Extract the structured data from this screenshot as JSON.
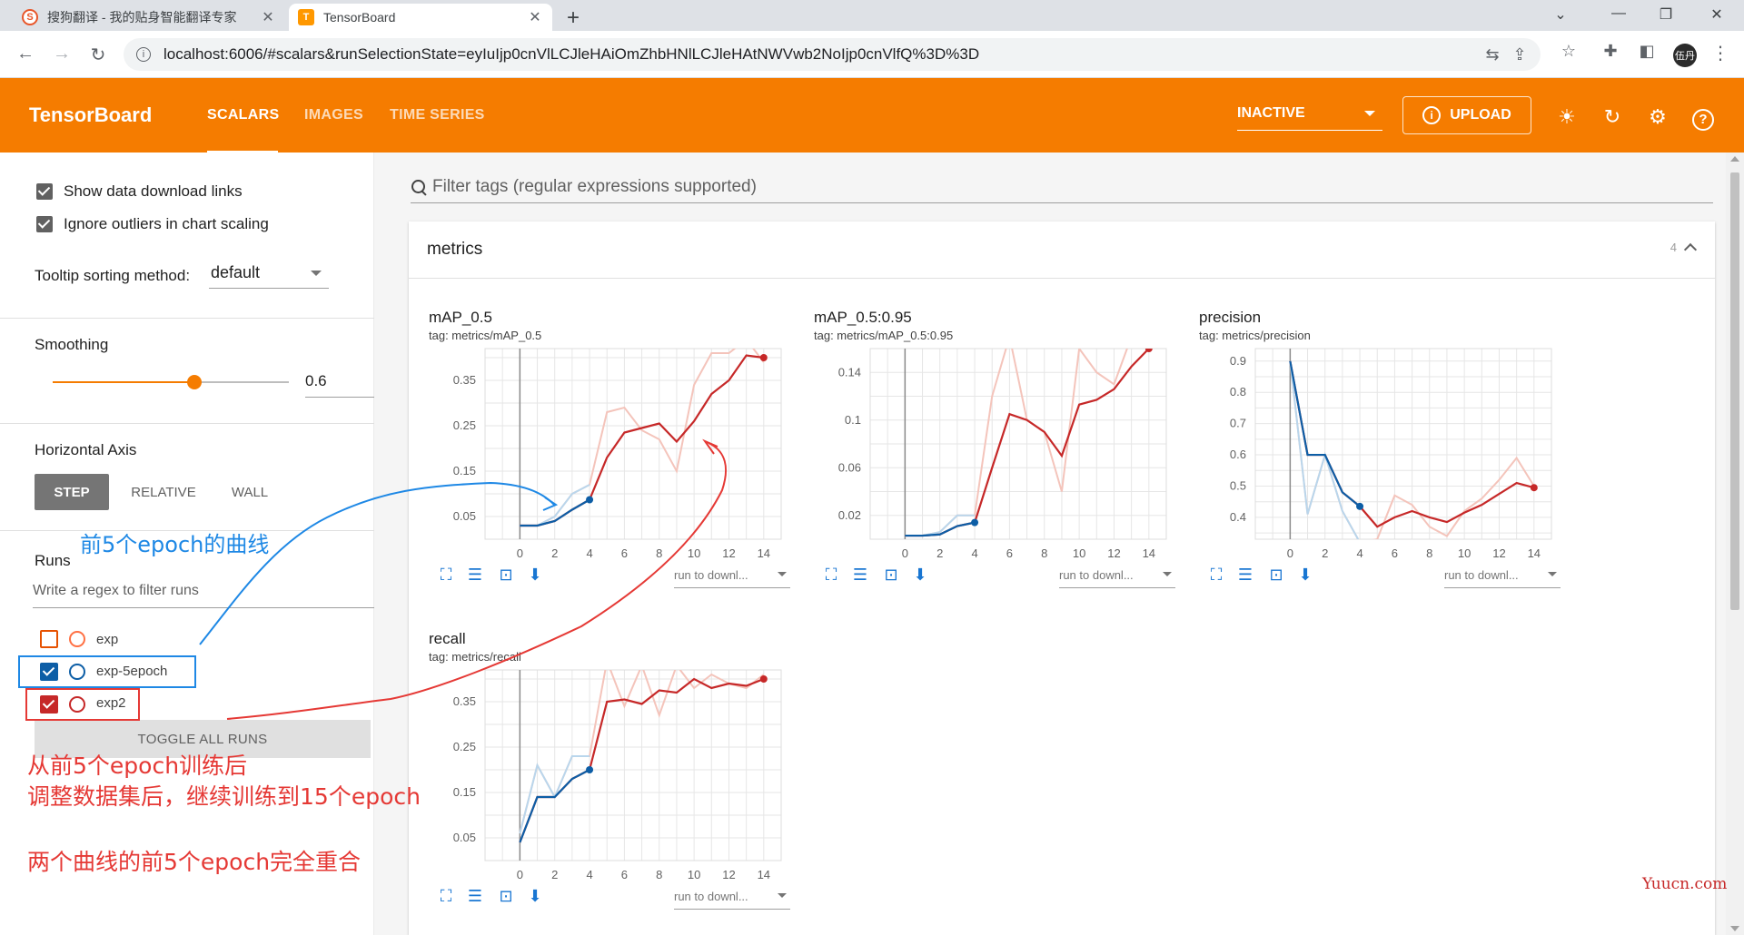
{
  "browser": {
    "tabs": [
      {
        "title": "搜狗翻译 - 我的贴身智能翻译专家",
        "active": false,
        "icon": "sogou-icon"
      },
      {
        "title": "TensorBoard",
        "active": true,
        "icon": "tensorboard-icon"
      }
    ],
    "url": "localhost:6006/#scalars&runSelectionState=eyIuIjp0cnVlLCJleHAiOmZhbHNlLCJleHAtNWVwb2NoIjp0cnVlfQ%3D%3D",
    "avatar_text": "伍丹"
  },
  "header": {
    "title": "TensorBoard",
    "tabs": [
      {
        "label": "SCALARS",
        "active": true
      },
      {
        "label": "IMAGES",
        "active": false
      },
      {
        "label": "TIME SERIES",
        "active": false
      }
    ],
    "reload_status": "INACTIVE",
    "upload_label": "UPLOAD",
    "accent": "#f57c00"
  },
  "sidebar": {
    "show_download_links": {
      "label": "Show data download links",
      "checked": true
    },
    "ignore_outliers": {
      "label": "Ignore outliers in chart scaling",
      "checked": true
    },
    "tooltip_sorting": {
      "label": "Tooltip sorting method:",
      "value": "default"
    },
    "smoothing": {
      "label": "Smoothing",
      "value": "0.6",
      "fraction": 0.6
    },
    "horizontal_axis": {
      "label": "Horizontal Axis",
      "options": [
        "STEP",
        "RELATIVE",
        "WALL"
      ],
      "selected": "STEP"
    },
    "runs": {
      "label": "Runs",
      "filter_placeholder": "Write a regex to filter runs",
      "items": [
        {
          "name": "exp",
          "checked": false,
          "color": "#ff7043"
        },
        {
          "name": "exp-5epoch",
          "checked": true,
          "color": "#0d5ea6"
        },
        {
          "name": "exp2",
          "checked": true,
          "color": "#c62828"
        }
      ],
      "toggle_label": "TOGGLE ALL RUNS"
    }
  },
  "main": {
    "filter_placeholder": "Filter tags (regular expressions supported)",
    "card": {
      "title": "metrics",
      "count": "4"
    },
    "run_download_label": "run to downl..."
  },
  "chart_data": [
    {
      "type": "line",
      "title": "mAP_0.5",
      "tag": "tag: metrics/mAP_0.5",
      "xlim": [
        -2,
        15
      ],
      "ylim": [
        0.0,
        0.42
      ],
      "xticks": [
        "0",
        "2",
        "4",
        "6",
        "8",
        "10",
        "12",
        "14"
      ],
      "yticks": [
        "0.05",
        "0.15",
        "0.25",
        "0.35"
      ],
      "series": [
        {
          "name": "exp-5epoch",
          "color": "#0d5ea6",
          "x": [
            0,
            1,
            2,
            3,
            4
          ],
          "raw": [
            0.03,
            0.03,
            0.05,
            0.1,
            0.12
          ],
          "smoothed": [
            0.03,
            0.03,
            0.04,
            0.065,
            0.087
          ]
        },
        {
          "name": "exp2",
          "color": "#c62828",
          "x": [
            0,
            1,
            2,
            3,
            4,
            5,
            6,
            7,
            8,
            9,
            10,
            11,
            12,
            13,
            14
          ],
          "raw": [
            0.03,
            0.03,
            0.05,
            0.1,
            0.12,
            0.28,
            0.29,
            0.24,
            0.22,
            0.15,
            0.34,
            0.41,
            0.41,
            0.44,
            0.39
          ],
          "smoothed": [
            0.03,
            0.03,
            0.04,
            0.065,
            0.087,
            0.18,
            0.235,
            0.245,
            0.255,
            0.215,
            0.26,
            0.32,
            0.35,
            0.405,
            0.4
          ]
        }
      ]
    },
    {
      "type": "line",
      "title": "mAP_0.5:0.95",
      "tag": "tag: metrics/mAP_0.5:0.95",
      "xlim": [
        -2,
        15
      ],
      "ylim": [
        0.0,
        0.16
      ],
      "xticks": [
        "0",
        "2",
        "4",
        "6",
        "8",
        "10",
        "12",
        "14"
      ],
      "yticks": [
        "0.02",
        "0.06",
        "0.1",
        "0.14"
      ],
      "series": [
        {
          "name": "exp-5epoch",
          "color": "#0d5ea6",
          "x": [
            0,
            1,
            2,
            3,
            4
          ],
          "raw": [
            0.003,
            0.003,
            0.006,
            0.02,
            0.02
          ],
          "smoothed": [
            0.003,
            0.003,
            0.004,
            0.011,
            0.014
          ]
        },
        {
          "name": "exp2",
          "color": "#c62828",
          "x": [
            0,
            1,
            2,
            3,
            4,
            5,
            6,
            7,
            8,
            9,
            10,
            11,
            12,
            13,
            14
          ],
          "raw": [
            0.003,
            0.003,
            0.006,
            0.02,
            0.02,
            0.12,
            0.17,
            0.1,
            0.09,
            0.04,
            0.16,
            0.14,
            0.13,
            0.17,
            0.16
          ],
          "smoothed": [
            0.003,
            0.003,
            0.004,
            0.011,
            0.014,
            0.06,
            0.105,
            0.1,
            0.09,
            0.07,
            0.113,
            0.117,
            0.126,
            0.145,
            0.16
          ]
        }
      ]
    },
    {
      "type": "line",
      "title": "precision",
      "tag": "tag: metrics/precision",
      "xlim": [
        -2,
        15
      ],
      "ylim": [
        0.33,
        0.94
      ],
      "xticks": [
        "0",
        "2",
        "4",
        "6",
        "8",
        "10",
        "12",
        "14"
      ],
      "yticks": [
        "0.4",
        "0.5",
        "0.6",
        "0.7",
        "0.8",
        "0.9"
      ],
      "series": [
        {
          "name": "exp-5epoch",
          "color": "#0d5ea6",
          "x": [
            0,
            1,
            2,
            3,
            4
          ],
          "raw": [
            0.9,
            0.41,
            0.6,
            0.42,
            0.32
          ],
          "smoothed": [
            0.9,
            0.6,
            0.6,
            0.48,
            0.435
          ]
        },
        {
          "name": "exp2",
          "color": "#c62828",
          "x": [
            0,
            1,
            2,
            3,
            4,
            5,
            6,
            7,
            8,
            9,
            10,
            11,
            12,
            13,
            14
          ],
          "raw": [
            0.9,
            0.41,
            0.6,
            0.42,
            0.32,
            0.33,
            0.47,
            0.44,
            0.37,
            0.34,
            0.42,
            0.46,
            0.52,
            0.59,
            0.5
          ],
          "smoothed": [
            0.9,
            0.6,
            0.6,
            0.48,
            0.435,
            0.37,
            0.4,
            0.42,
            0.4,
            0.385,
            0.415,
            0.44,
            0.475,
            0.51,
            0.495
          ]
        }
      ]
    },
    {
      "type": "line",
      "title": "recall",
      "tag": "tag: metrics/recall",
      "xlim": [
        -2,
        15
      ],
      "ylim": [
        0.0,
        0.42
      ],
      "xticks": [
        "0",
        "2",
        "4",
        "6",
        "8",
        "10",
        "12",
        "14"
      ],
      "yticks": [
        "0.05",
        "0.15",
        "0.25",
        "0.35"
      ],
      "series": [
        {
          "name": "exp-5epoch",
          "color": "#0d5ea6",
          "x": [
            0,
            1,
            2,
            3,
            4
          ],
          "raw": [
            0.06,
            0.21,
            0.14,
            0.23,
            0.23
          ],
          "smoothed": [
            0.04,
            0.14,
            0.14,
            0.18,
            0.2
          ]
        },
        {
          "name": "exp2",
          "color": "#c62828",
          "x": [
            0,
            1,
            2,
            3,
            4,
            5,
            6,
            7,
            8,
            9,
            10,
            11,
            12,
            13,
            14
          ],
          "raw": [
            0.06,
            0.21,
            0.14,
            0.23,
            0.23,
            0.44,
            0.34,
            0.43,
            0.32,
            0.43,
            0.38,
            0.41,
            0.39,
            0.38,
            0.41
          ],
          "smoothed": [
            0.04,
            0.14,
            0.14,
            0.18,
            0.2,
            0.35,
            0.355,
            0.345,
            0.375,
            0.37,
            0.4,
            0.38,
            0.39,
            0.385,
            0.4
          ]
        }
      ]
    }
  ],
  "annotations": {
    "blue_note": "前5个epoch的曲线",
    "red_note_line1": "从前5个epoch训练后",
    "red_note_line2": "调整数据集后，继续训练到15个epoch",
    "red_note_line3": "两个曲线的前5个epoch完全重合",
    "watermark": "Yuucn.com"
  }
}
